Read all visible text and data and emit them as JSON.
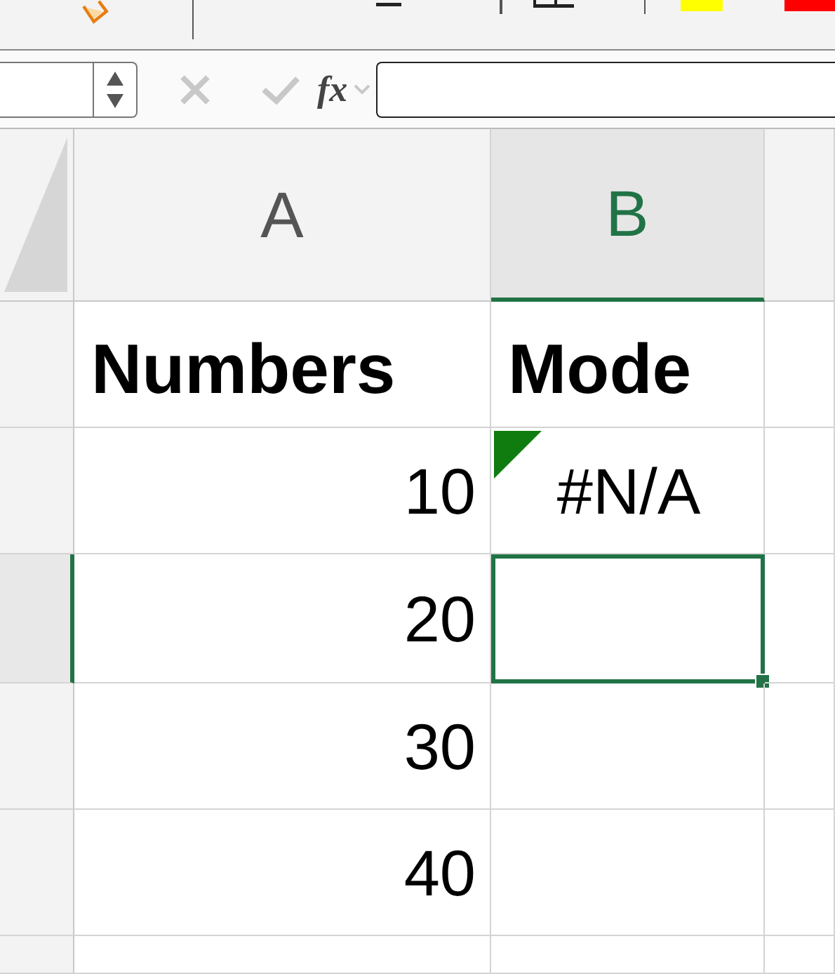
{
  "formula_bar": {
    "function_label": "fx"
  },
  "columns": [
    {
      "label": "A",
      "selected": false
    },
    {
      "label": "B",
      "selected": true
    },
    {
      "selected": false
    }
  ],
  "rows": [
    {
      "selected": false,
      "cells": [
        {
          "kind": "header",
          "text": "Numbers",
          "selected": false
        },
        {
          "kind": "header",
          "text": "Mode",
          "selected": false
        },
        {
          "kind": "empty",
          "selected": false
        }
      ]
    },
    {
      "selected": false,
      "cells": [
        {
          "kind": "number",
          "text": "10",
          "selected": false
        },
        {
          "kind": "error",
          "text": "#N/A",
          "selected": false
        },
        {
          "kind": "empty",
          "selected": false
        }
      ]
    },
    {
      "selected": true,
      "cells": [
        {
          "kind": "number",
          "text": "20",
          "selected": false
        },
        {
          "kind": "empty",
          "selected": true
        },
        {
          "kind": "empty",
          "selected": false
        }
      ]
    },
    {
      "selected": false,
      "cells": [
        {
          "kind": "number",
          "text": "30",
          "selected": false
        },
        {
          "kind": "empty",
          "selected": false
        },
        {
          "kind": "empty",
          "selected": false
        }
      ]
    },
    {
      "selected": false,
      "cells": [
        {
          "kind": "number",
          "text": "40",
          "selected": false
        },
        {
          "kind": "empty",
          "selected": false
        },
        {
          "kind": "empty",
          "selected": false
        }
      ]
    },
    {
      "selected": false,
      "cells": [
        {
          "kind": "empty",
          "selected": false
        },
        {
          "kind": "empty",
          "selected": false
        },
        {
          "kind": "empty",
          "selected": false
        }
      ]
    }
  ]
}
